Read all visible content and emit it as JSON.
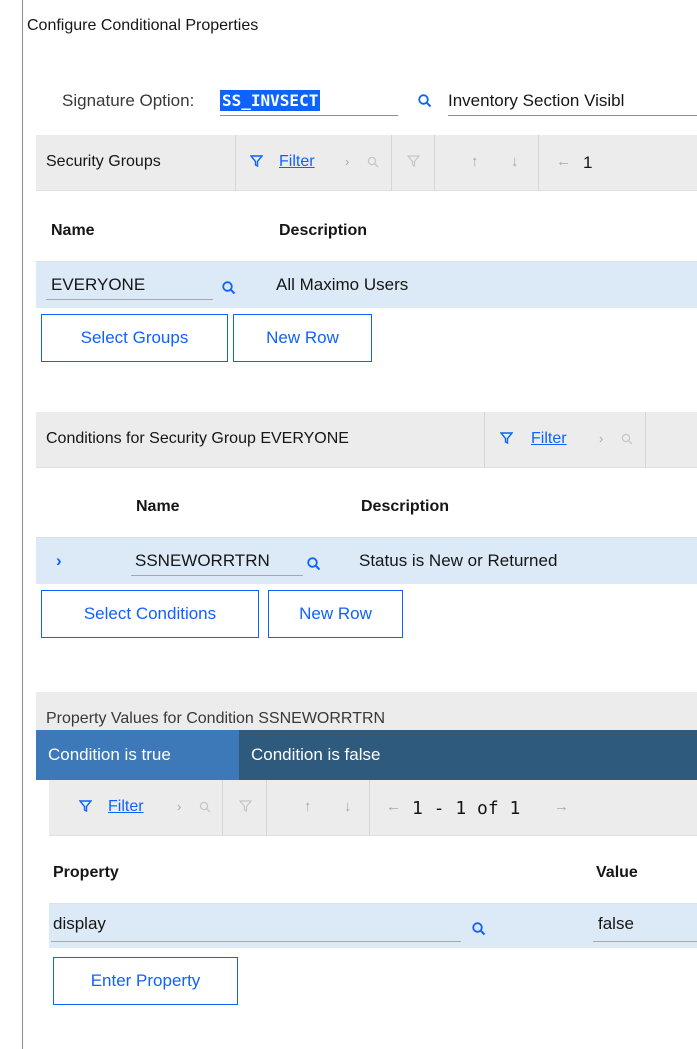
{
  "dialog": {
    "title": "Configure Conditional Properties"
  },
  "signature": {
    "label": "Signature Option:",
    "value": "SS_INVSECT",
    "description": "Inventory Section Visibl"
  },
  "security_groups": {
    "title": "Security Groups",
    "filter_label": "Filter",
    "pager": "1",
    "columns": [
      "Name",
      "Description"
    ],
    "rows": [
      {
        "name": "EVERYONE",
        "description": "All Maximo Users"
      }
    ],
    "select_button": "Select Groups",
    "new_row_button": "New Row"
  },
  "conditions": {
    "title": "Conditions for Security Group EVERYONE",
    "filter_label": "Filter",
    "columns": [
      "Name",
      "Description"
    ],
    "rows": [
      {
        "name": "SSNEWORRTRN",
        "description": "Status is New or Returned"
      }
    ],
    "select_button": "Select Conditions",
    "new_row_button": "New Row"
  },
  "property_values": {
    "title": "Property Values for Condition SSNEWORRTRN",
    "tabs": [
      {
        "label": "Condition is true",
        "active": true
      },
      {
        "label": "Condition is false",
        "active": false
      }
    ],
    "filter_label": "Filter",
    "pager": "1 - 1 of 1",
    "columns": [
      "Property",
      "Value"
    ],
    "rows": [
      {
        "property": "display",
        "value": "false"
      }
    ],
    "enter_button": "Enter Property"
  },
  "colors": {
    "accent": "#0f62fe",
    "row_selected": "#dbeaf6",
    "tab_bar": "#2e5a7e",
    "tab_active": "#3d79b8",
    "toolbar_bg": "#ececec",
    "lookup_icon": "#0f62fe"
  },
  "icons": [
    "search-icon",
    "filter-icon",
    "chevron-right-icon",
    "clear-filter-icon",
    "arrow-up-icon",
    "arrow-down-icon",
    "arrow-left-icon",
    "arrow-right-icon",
    "chevron-expand-icon"
  ]
}
